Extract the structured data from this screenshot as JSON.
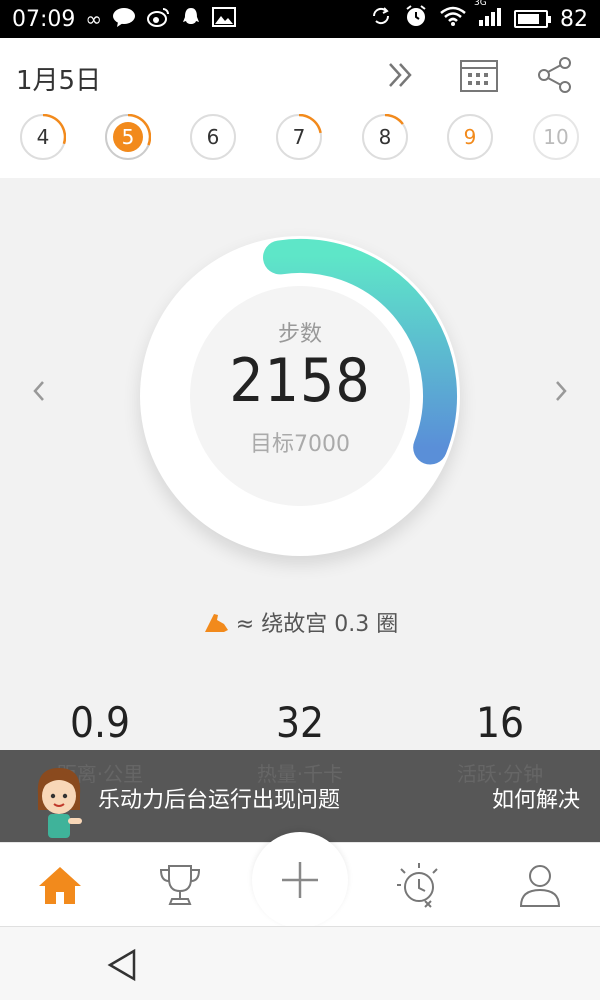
{
  "status_bar": {
    "time": "07:09",
    "battery": "82",
    "battery_level": 0.82,
    "network": "3G",
    "left_icons": [
      "infinity-icon",
      "chat-bubble-icon",
      "weibo-icon",
      "qq-icon",
      "image-icon"
    ],
    "right_icons": [
      "sync-icon",
      "alarm-icon",
      "wifi-icon",
      "signal-icon",
      "battery-icon"
    ]
  },
  "header": {
    "date": "1月5日",
    "icons": [
      "double-chevron-right-icon",
      "calendar-icon",
      "share-icon"
    ]
  },
  "days": [
    {
      "label": "4",
      "progress": 0.3
    },
    {
      "label": "5",
      "progress": 0.31,
      "selected": true
    },
    {
      "label": "6",
      "progress": 0
    },
    {
      "label": "7",
      "progress": 0.22
    },
    {
      "label": "8",
      "progress": 0.15
    },
    {
      "label": "9",
      "progress": 0,
      "today": true
    },
    {
      "label": "10",
      "progress": 0,
      "future": true
    }
  ],
  "steps": {
    "label": "步数",
    "value": "2158",
    "goal": "目标7000",
    "progress": 0.31
  },
  "laps": {
    "text": "≈ 绕故宫 0.3 圈"
  },
  "stats": [
    {
      "value": "0.9",
      "label": "距离·公里"
    },
    {
      "value": "32",
      "label": "热量·千卡"
    },
    {
      "value": "16",
      "label": "活跃·分钟"
    }
  ],
  "banner": {
    "message": "乐动力后台运行出现问题",
    "action": "如何解决"
  },
  "tabs": [
    "home-icon",
    "trophy-icon",
    "plus-icon",
    "insight-icon",
    "profile-icon"
  ],
  "colors": {
    "accent": "#f28a1c",
    "ring_start": "#5ee6c8",
    "ring_end": "#5a8fd8"
  }
}
